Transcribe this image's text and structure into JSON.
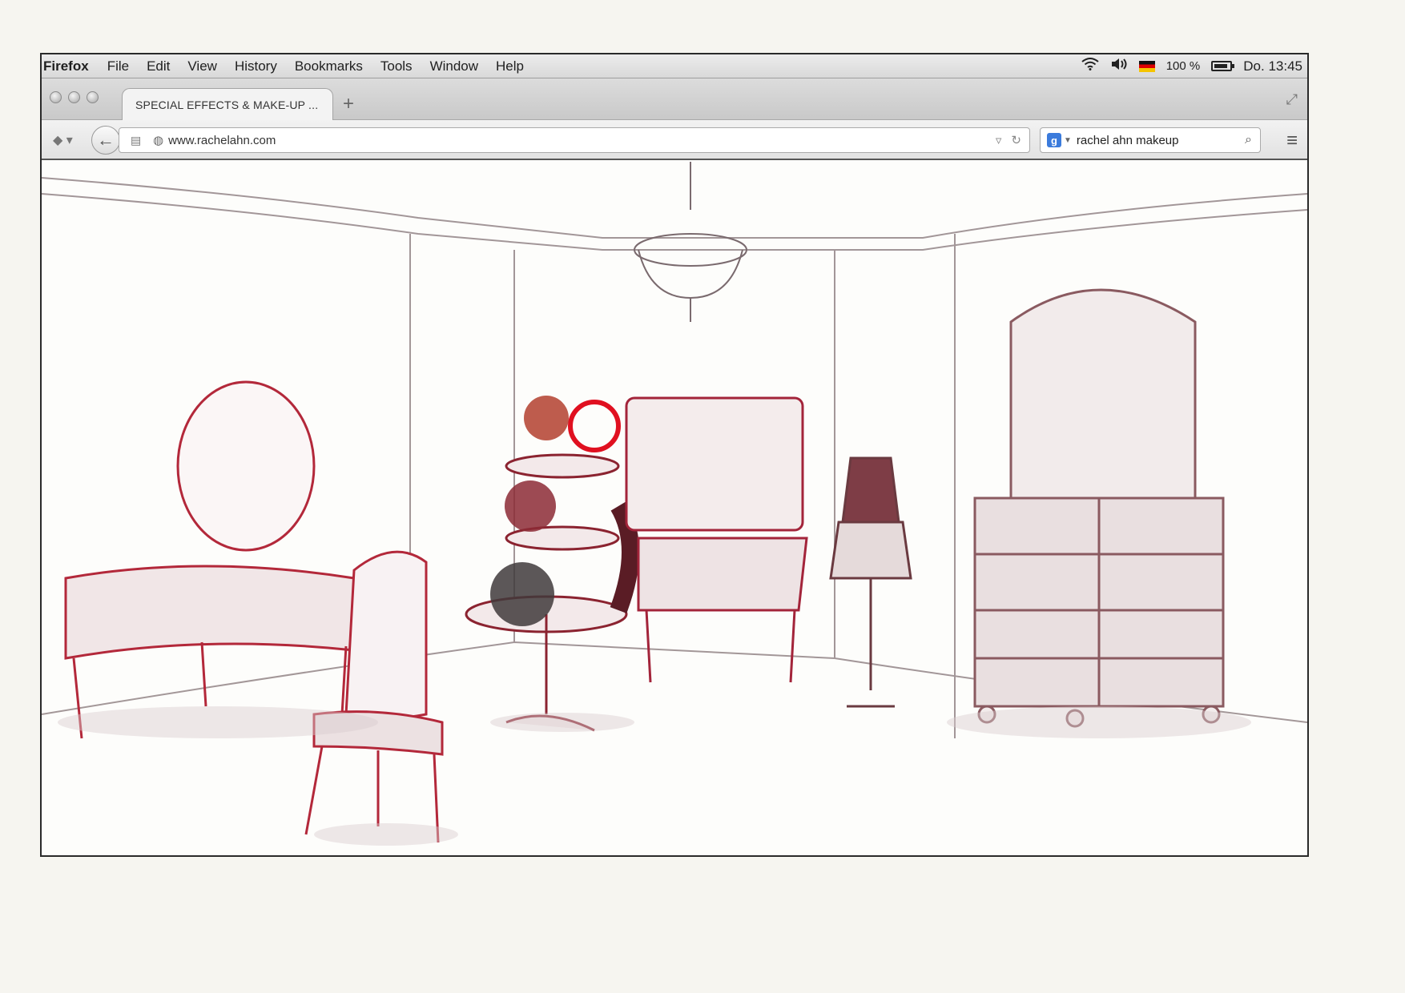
{
  "menubar": {
    "app": "Firefox",
    "items": [
      "File",
      "Edit",
      "View",
      "History",
      "Bookmarks",
      "Tools",
      "Window",
      "Help"
    ],
    "status": {
      "wifi": "wifi-icon",
      "volume": "volume-icon",
      "battery_percent": "100 %",
      "clock": "Do. 13:45"
    }
  },
  "tabs": [
    {
      "title": "SPECIAL EFFECTS & MAKE-UP ..."
    }
  ],
  "newtab_label": "+",
  "navbar": {
    "url": "www.rachelahn.com",
    "search_value": "rachel ahn makeup"
  },
  "colors": {
    "sketch_red": "#b3283a",
    "sketch_gray": "#6b5b5e",
    "chrome": "#dcdcdc"
  },
  "icons": [
    "back-arrow-icon",
    "globe-icon",
    "reload-icon",
    "search-icon",
    "hamburger-menu-icon",
    "fullscreen-icon"
  ]
}
